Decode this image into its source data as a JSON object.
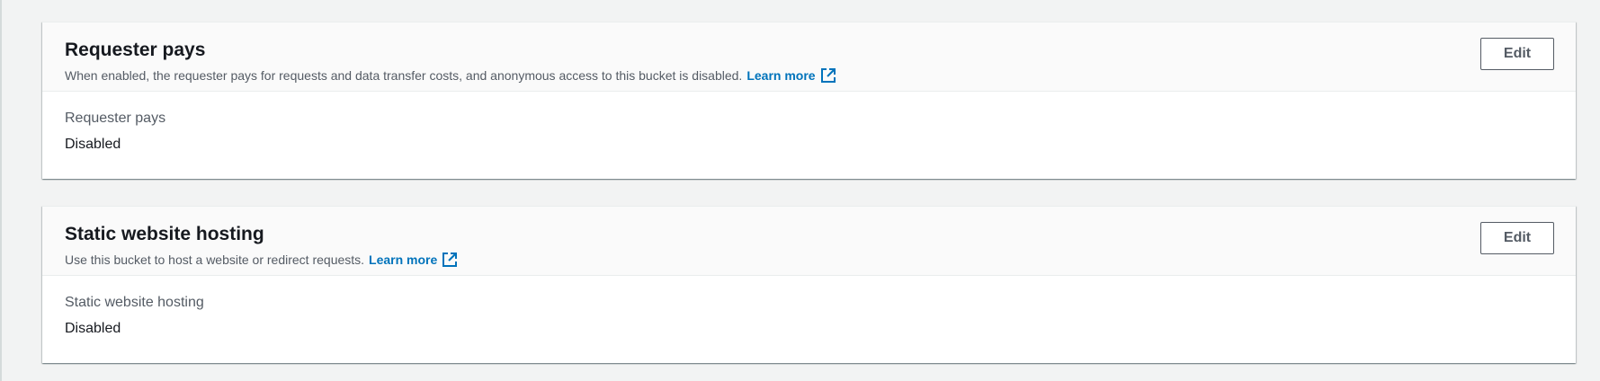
{
  "requester_pays": {
    "title": "Requester pays",
    "description": "When enabled, the requester pays for requests and data transfer costs, and anonymous access to this bucket is disabled.",
    "learn_more_label": "Learn more",
    "learn_more_icon": "external-link-icon",
    "edit_label": "Edit",
    "field_label": "Requester pays",
    "field_value": "Disabled"
  },
  "static_website_hosting": {
    "title": "Static website hosting",
    "description": "Use this bucket to host a website or redirect requests.",
    "learn_more_label": "Learn more",
    "learn_more_icon": "external-link-icon",
    "edit_label": "Edit",
    "field_label": "Static website hosting",
    "field_value": "Disabled"
  },
  "colors": {
    "page_background": "#f2f3f3",
    "panel_header_background": "#fafafa",
    "link": "#0073bb",
    "secondary_text": "#545b64",
    "primary_text": "#16191f"
  }
}
